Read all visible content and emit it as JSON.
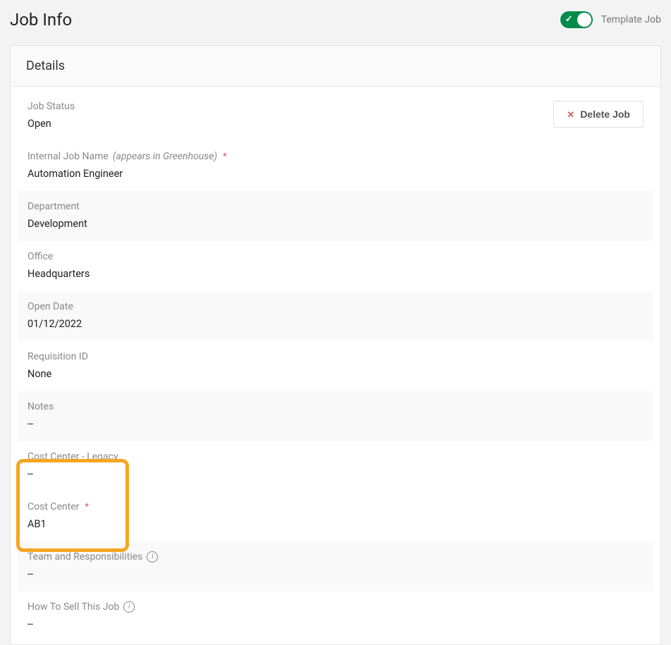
{
  "header": {
    "pageTitle": "Job Info",
    "toggleLabel": "Template Job",
    "toggleOn": true
  },
  "details": {
    "sectionTitle": "Details",
    "deleteLabel": "Delete Job",
    "fields": {
      "jobStatus": {
        "label": "Job Status",
        "value": "Open"
      },
      "internalJobName": {
        "label": "Internal Job Name",
        "hint": "(appears in Greenhouse)",
        "required": true,
        "value": "Automation Engineer"
      },
      "department": {
        "label": "Department",
        "value": "Development"
      },
      "office": {
        "label": "Office",
        "value": "Headquarters"
      },
      "openDate": {
        "label": "Open Date",
        "value": "01/12/2022"
      },
      "requisitionId": {
        "label": "Requisition ID",
        "value": "None"
      },
      "notes": {
        "label": "Notes",
        "value": "--"
      },
      "costCenterLegacy": {
        "label": "Cost Center - Legacy",
        "value": "--"
      },
      "costCenter": {
        "label": "Cost Center",
        "required": true,
        "value": "AB1"
      },
      "teamResponsibilities": {
        "label": "Team and Responsibilities",
        "value": "--"
      },
      "howToSell": {
        "label": "How To Sell This Job",
        "value": "--"
      }
    }
  }
}
